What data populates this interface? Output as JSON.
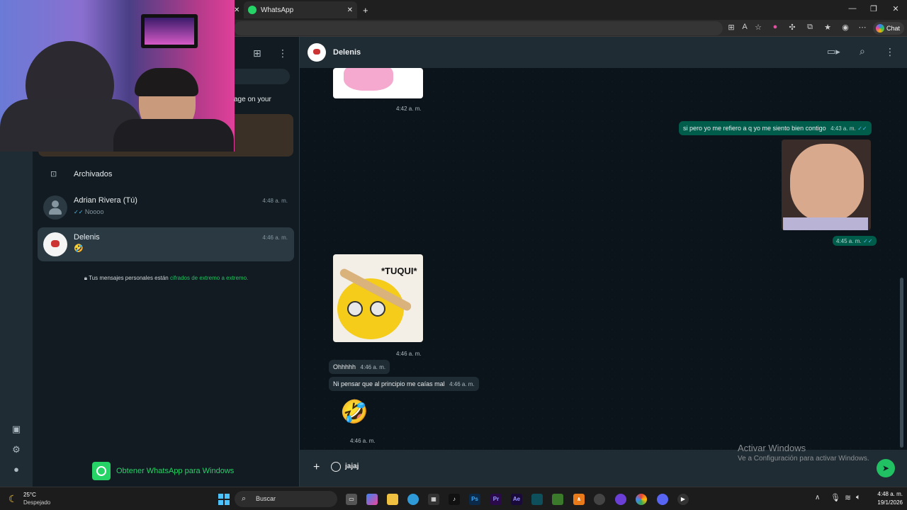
{
  "browser": {
    "tab_title": "WhatsApp",
    "new_tab_label": "+",
    "chat_button": "Chat"
  },
  "sidebar": {
    "banner_text": "age on your",
    "archived_label": "Archivados",
    "chats": [
      {
        "name": "Adrian Rivera (Tú)",
        "preview": "Noooo",
        "time": "4:48 a. m."
      },
      {
        "name": "Delenis",
        "preview": "🤣",
        "time": "4:46 a. m."
      }
    ],
    "encryption_text": "Tus mensajes personales están",
    "encryption_link": "cifrados de extremo a extremo.",
    "get_app": "Obtener WhatsApp para Windows"
  },
  "conversation": {
    "contact_name": "Delenis",
    "messages": {
      "img1_time": "4:42 a. m.",
      "out1_text": "si pero yo me refiero a q yo me siento bien contigo",
      "out1_time": "4:43 a. m.",
      "out_img_time": "4:45 a. m.",
      "sticker_caption": "*TUQUI*",
      "sticker_time": "4:46 a. m.",
      "in1_text": "Ohhhhh",
      "in1_time": "4:46 a. m.",
      "in2_text": "Ni pensar que al principio me caías mal",
      "in2_time": "4:46 a. m.",
      "emoji": "🤣",
      "emoji_time": "4:46 a. m."
    },
    "composer_value": "jajaj",
    "watermark_title": "Activar Windows",
    "watermark_sub": "Ve a Configuración para activar Windows."
  },
  "taskbar": {
    "weather_temp": "25°C",
    "weather_desc": "Despejado",
    "search_label": "Buscar",
    "clock_time": "4:48 a. m.",
    "clock_date": "19/1/2026"
  },
  "colors": {
    "accent": "#21c063",
    "bubble_out": "#005c4b",
    "bubble_in": "#202c33",
    "panel": "#111b21"
  }
}
